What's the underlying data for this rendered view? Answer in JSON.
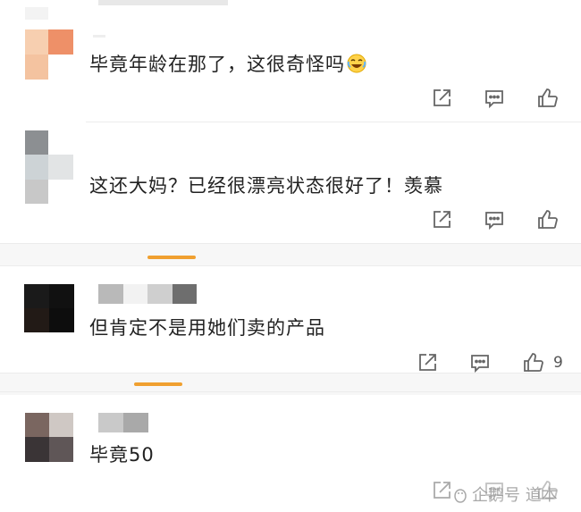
{
  "comments": [
    {
      "text": "毕竟年龄在那了，这很奇怪吗",
      "emoji": "laugh-cry-emoji",
      "like_count": ""
    },
    {
      "text": "这还大妈？已经很漂亮状态很好了！羡慕",
      "like_count": ""
    },
    {
      "text": "但肯定不是用她们卖的产品",
      "like_count": "9"
    },
    {
      "text": "毕竟50",
      "like_count": ""
    }
  ],
  "action_icons": {
    "share": "share-icon",
    "reply": "reply-icon",
    "like": "thumbs-up-icon"
  },
  "watermark": {
    "text": "企鹅号 道本"
  },
  "colors": {
    "accent": "#f0a030",
    "icon": "#666666",
    "text": "#222222"
  }
}
